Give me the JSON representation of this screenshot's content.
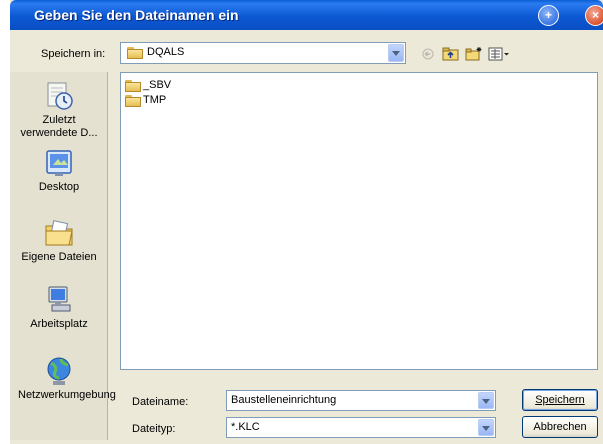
{
  "dialog": {
    "title": "Geben Sie den Dateinamen ein",
    "help_glyph": "+",
    "close_glyph": "×"
  },
  "lookin": {
    "label": "Speichern in:",
    "value": "DQALS"
  },
  "toolbar": {
    "icons": [
      "back-icon",
      "up-folder-icon",
      "new-folder-icon",
      "view-menu-icon"
    ]
  },
  "places": [
    {
      "label": "Zuletzt verwendete D...",
      "icon": "recent-documents-icon"
    },
    {
      "label": "Desktop",
      "icon": "desktop-icon"
    },
    {
      "label": "Eigene Dateien",
      "icon": "my-documents-icon"
    },
    {
      "label": "Arbeitsplatz",
      "icon": "my-computer-icon"
    },
    {
      "label": "Netzwerkumgebung",
      "icon": "network-icon"
    }
  ],
  "files": [
    {
      "name": "_SBV",
      "icon": "folder-icon"
    },
    {
      "name": "TMP",
      "icon": "folder-icon"
    }
  ],
  "filename": {
    "label": "Dateiname:",
    "value": "Baustelleneinrichtung"
  },
  "filetype": {
    "label": "Dateityp:",
    "value": "*.KLC"
  },
  "buttons": {
    "save": "Speichern",
    "cancel": "Abbrechen"
  },
  "colors": {
    "titlebar": "#0a5fd6",
    "dialog_bg": "#ece9d8",
    "field_border": "#7f9db9"
  }
}
